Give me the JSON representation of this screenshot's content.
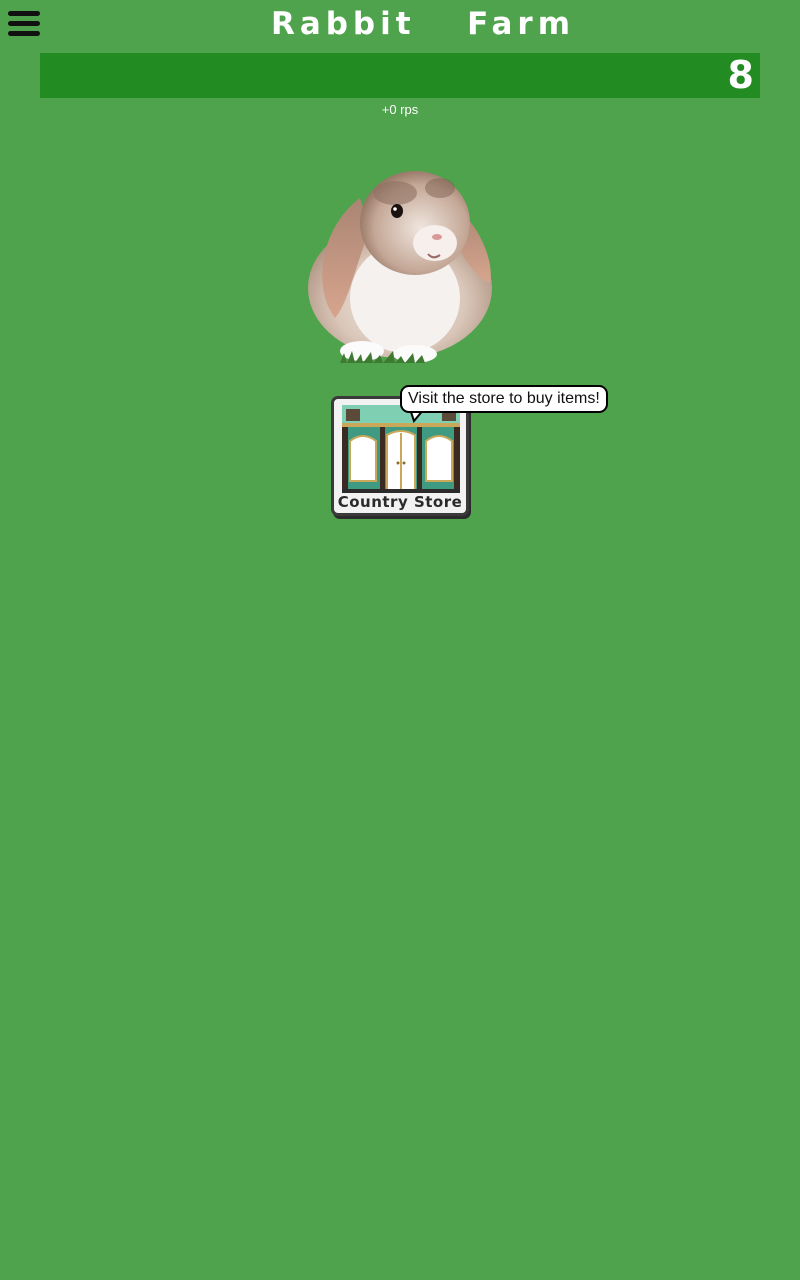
{
  "app": {
    "title": "Rabbit  Farm",
    "menu_icon": "hamburger-menu-icon"
  },
  "counter": {
    "value": "8",
    "rate": "+0 rps"
  },
  "rabbit": {
    "icon": "rabbit-image"
  },
  "store": {
    "label": "Country Store",
    "icon": "storefront-icon",
    "tooltip": "Visit the store to buy items!"
  },
  "colors": {
    "background": "#4fa34c",
    "counter_bar": "#228b22",
    "text": "#ffffff"
  }
}
